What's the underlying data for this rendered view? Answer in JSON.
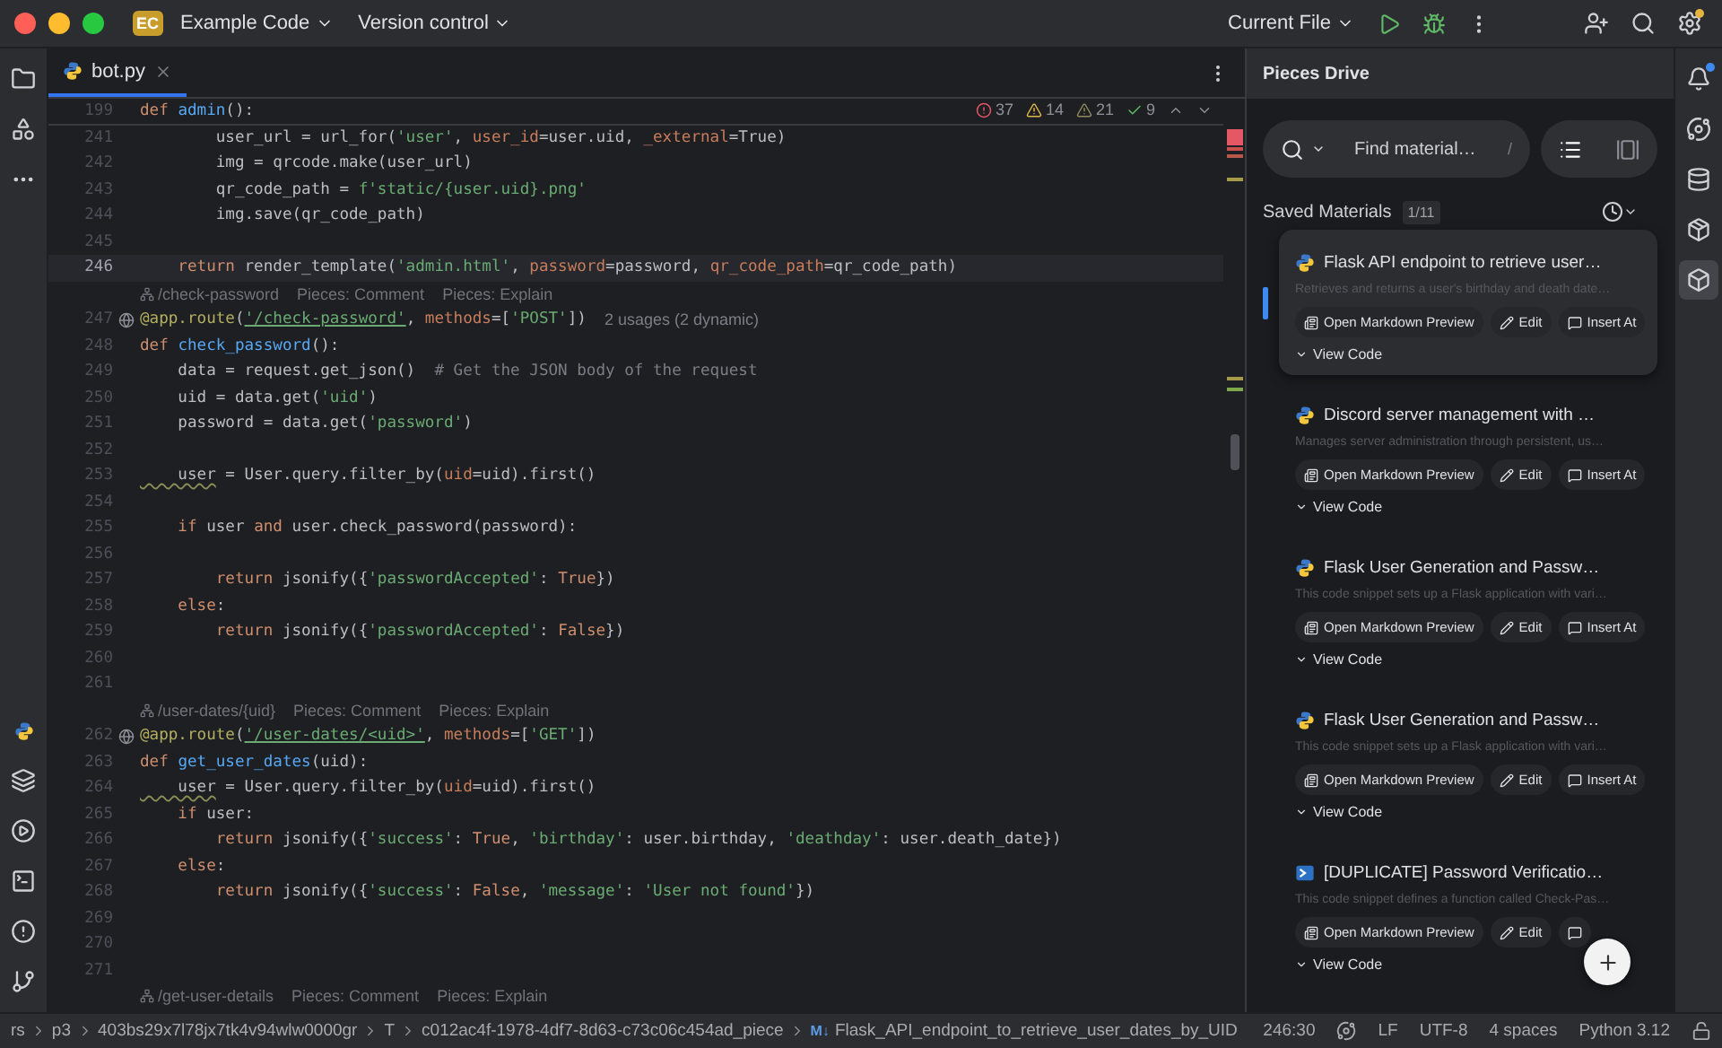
{
  "titlebar": {
    "project_badge": "EC",
    "project": "Example Code",
    "vcs": "Version control",
    "run_config": "Current File"
  },
  "left_toolbar": [
    {
      "selected": false
    },
    {
      "selected": false
    }
  ],
  "right_toolbar": [
    {
      "selected": false
    },
    {
      "selected": false
    },
    {
      "selected": false
    },
    {
      "selected": false
    },
    {
      "selected": true
    }
  ],
  "tabs": [
    {
      "label": "bot.py",
      "selected": true
    }
  ],
  "inspections": [
    {
      "kind": "error",
      "count": "37"
    },
    {
      "kind": "warning",
      "count": "14"
    },
    {
      "kind": "weak",
      "count": "21"
    },
    {
      "kind": "typo",
      "count": "9"
    }
  ],
  "editor": {
    "rows": [
      {
        "kind": "code",
        "num": "199",
        "sticky": true,
        "segs": [
          {
            "text": "def ",
            "kind": "k"
          },
          {
            "text": "admin",
            "kind": "f"
          },
          {
            "text": "():",
            "kind": "n"
          }
        ]
      },
      {
        "kind": "code",
        "num": "241",
        "segs": [
          {
            "text": "        user_url = url_for(",
            "kind": "n"
          },
          {
            "text": "'user'",
            "kind": "s"
          },
          {
            "text": ", ",
            "kind": "n"
          },
          {
            "text": "user_id",
            "kind": "p"
          },
          {
            "text": "=user.uid, ",
            "kind": "n"
          },
          {
            "text": "_external",
            "kind": "p"
          },
          {
            "text": "=True)",
            "kind": "n"
          }
        ]
      },
      {
        "kind": "code",
        "num": "242",
        "segs": [
          {
            "text": "        img = qrcode.make(user_url)",
            "kind": "n"
          }
        ]
      },
      {
        "kind": "code",
        "num": "243",
        "segs": [
          {
            "text": "        qr_code_path = ",
            "kind": "n"
          },
          {
            "text": "f'static/{user.uid}.png'",
            "kind": "s"
          }
        ]
      },
      {
        "kind": "code",
        "num": "244",
        "segs": [
          {
            "text": "        img.save(qr_code_path)",
            "kind": "n"
          }
        ]
      },
      {
        "kind": "code",
        "num": "245"
      },
      {
        "kind": "code",
        "num": "246",
        "current": true,
        "segs": [
          {
            "text": "    return",
            "kind": "k"
          },
          {
            "text": " render_template(",
            "kind": "n"
          },
          {
            "text": "'admin.html'",
            "kind": "s"
          },
          {
            "text": ", ",
            "kind": "n"
          },
          {
            "text": "password",
            "kind": "p"
          },
          {
            "text": "=password, ",
            "kind": "n"
          },
          {
            "text": "qr_code_path",
            "kind": "p"
          },
          {
            "text": "=qr_code_path)",
            "kind": "n"
          }
        ]
      },
      {
        "kind": "hint",
        "route": "/check-password",
        "links": [
          "Pieces: Comment",
          "Pieces: Explain"
        ]
      },
      {
        "kind": "code",
        "num": "247",
        "route_marker": true,
        "inlay": "2 usages (2 dynamic)",
        "segs": [
          {
            "text": "@app.route",
            "kind": "d"
          },
          {
            "text": "(",
            "kind": "n"
          },
          {
            "text": "'/check-password'",
            "kind": "u"
          },
          {
            "text": ", ",
            "kind": "n"
          },
          {
            "text": "methods",
            "kind": "p"
          },
          {
            "text": "=[",
            "kind": "n"
          },
          {
            "text": "'POST'",
            "kind": "s"
          },
          {
            "text": "])",
            "kind": "n"
          }
        ]
      },
      {
        "kind": "code",
        "num": "248",
        "segs": [
          {
            "text": "def ",
            "kind": "k"
          },
          {
            "text": "check_password",
            "kind": "f"
          },
          {
            "text": "():",
            "kind": "n"
          }
        ]
      },
      {
        "kind": "code",
        "num": "249",
        "segs": [
          {
            "text": "    data = request.get_json()  ",
            "kind": "n"
          },
          {
            "text": "# Get the JSON body of the request",
            "kind": "c"
          }
        ]
      },
      {
        "kind": "code",
        "num": "250",
        "segs": [
          {
            "text": "    uid = data.get(",
            "kind": "n"
          },
          {
            "text": "'uid'",
            "kind": "s"
          },
          {
            "text": ")",
            "kind": "n"
          }
        ]
      },
      {
        "kind": "code",
        "num": "251",
        "segs": [
          {
            "text": "    password = data.get(",
            "kind": "n"
          },
          {
            "text": "'password'",
            "kind": "s"
          },
          {
            "text": ")",
            "kind": "n"
          }
        ]
      },
      {
        "kind": "code",
        "num": "252"
      },
      {
        "kind": "code",
        "num": "253",
        "segs": [
          {
            "text": "    user",
            "kind": "w"
          },
          {
            "text": " = User.query.filter_by(",
            "kind": "n"
          },
          {
            "text": "uid",
            "kind": "p"
          },
          {
            "text": "=uid).first()",
            "kind": "n"
          }
        ]
      },
      {
        "kind": "code",
        "num": "254"
      },
      {
        "kind": "code",
        "num": "255",
        "segs": [
          {
            "text": "    if",
            "kind": "k"
          },
          {
            "text": " user ",
            "kind": "n"
          },
          {
            "text": "and",
            "kind": "k"
          },
          {
            "text": " user.check_password(password):",
            "kind": "n"
          }
        ]
      },
      {
        "kind": "code",
        "num": "256"
      },
      {
        "kind": "code",
        "num": "257",
        "segs": [
          {
            "text": "        return",
            "kind": "k"
          },
          {
            "text": " jsonify({",
            "kind": "n"
          },
          {
            "text": "'passwordAccepted'",
            "kind": "s"
          },
          {
            "text": ": ",
            "kind": "n"
          },
          {
            "text": "True",
            "kind": "k"
          },
          {
            "text": "})",
            "kind": "n"
          }
        ]
      },
      {
        "kind": "code",
        "num": "258",
        "segs": [
          {
            "text": "    else",
            "kind": "k"
          },
          {
            "text": ":",
            "kind": "n"
          }
        ]
      },
      {
        "kind": "code",
        "num": "259",
        "segs": [
          {
            "text": "        return",
            "kind": "k"
          },
          {
            "text": " jsonify({",
            "kind": "n"
          },
          {
            "text": "'passwordAccepted'",
            "kind": "s"
          },
          {
            "text": ": ",
            "kind": "n"
          },
          {
            "text": "False",
            "kind": "k"
          },
          {
            "text": "})",
            "kind": "n"
          }
        ]
      },
      {
        "kind": "code",
        "num": "260"
      },
      {
        "kind": "code",
        "num": "261"
      },
      {
        "kind": "hint",
        "route": "/user-dates/{uid}",
        "links": [
          "Pieces: Comment",
          "Pieces: Explain"
        ]
      },
      {
        "kind": "code",
        "num": "262",
        "route_marker": true,
        "segs": [
          {
            "text": "@app.route",
            "kind": "d"
          },
          {
            "text": "(",
            "kind": "n"
          },
          {
            "text": "'/user-dates/<uid>'",
            "kind": "u"
          },
          {
            "text": ", ",
            "kind": "n"
          },
          {
            "text": "methods",
            "kind": "p"
          },
          {
            "text": "=[",
            "kind": "n"
          },
          {
            "text": "'GET'",
            "kind": "s"
          },
          {
            "text": "])",
            "kind": "n"
          }
        ]
      },
      {
        "kind": "code",
        "num": "263",
        "segs": [
          {
            "text": "def ",
            "kind": "k"
          },
          {
            "text": "get_user_dates",
            "kind": "f"
          },
          {
            "text": "(uid):",
            "kind": "n"
          }
        ]
      },
      {
        "kind": "code",
        "num": "264",
        "segs": [
          {
            "text": "    user",
            "kind": "w"
          },
          {
            "text": " = User.query.filter_by(",
            "kind": "n"
          },
          {
            "text": "uid",
            "kind": "p"
          },
          {
            "text": "=uid).first()",
            "kind": "n"
          }
        ]
      },
      {
        "kind": "code",
        "num": "265",
        "segs": [
          {
            "text": "    if",
            "kind": "k"
          },
          {
            "text": " user:",
            "kind": "n"
          }
        ]
      },
      {
        "kind": "code",
        "num": "266",
        "segs": [
          {
            "text": "        return",
            "kind": "k"
          },
          {
            "text": " jsonify({",
            "kind": "n"
          },
          {
            "text": "'success'",
            "kind": "s"
          },
          {
            "text": ": ",
            "kind": "n"
          },
          {
            "text": "True",
            "kind": "k"
          },
          {
            "text": ", ",
            "kind": "n"
          },
          {
            "text": "'birthday'",
            "kind": "s"
          },
          {
            "text": ": user.birthday, ",
            "kind": "n"
          },
          {
            "text": "'deathday'",
            "kind": "s"
          },
          {
            "text": ": user.death_date})",
            "kind": "n"
          }
        ]
      },
      {
        "kind": "code",
        "num": "267",
        "segs": [
          {
            "text": "    else",
            "kind": "k"
          },
          {
            "text": ":",
            "kind": "n"
          }
        ]
      },
      {
        "kind": "code",
        "num": "268",
        "segs": [
          {
            "text": "        return",
            "kind": "k"
          },
          {
            "text": " jsonify({",
            "kind": "n"
          },
          {
            "text": "'success'",
            "kind": "s"
          },
          {
            "text": ": ",
            "kind": "n"
          },
          {
            "text": "False",
            "kind": "k"
          },
          {
            "text": ", ",
            "kind": "n"
          },
          {
            "text": "'message'",
            "kind": "s"
          },
          {
            "text": ": ",
            "kind": "n"
          },
          {
            "text": "'User not found'",
            "kind": "s"
          },
          {
            "text": "})",
            "kind": "n"
          }
        ]
      },
      {
        "kind": "code",
        "num": "269"
      },
      {
        "kind": "code",
        "num": "270"
      },
      {
        "kind": "code",
        "num": "271"
      },
      {
        "kind": "hint",
        "route": "/get-user-details",
        "links": [
          "Pieces: Comment",
          "Pieces: Explain"
        ]
      }
    ]
  },
  "pieces": {
    "title": "Pieces Drive",
    "search": {
      "placeholder": "Find material…",
      "shortcut": "/"
    },
    "views": [
      {
        "selected": true
      },
      {
        "selected": false
      }
    ],
    "section": "Saved Materials",
    "count": "1/11",
    "materials": [
      {
        "kind": "python",
        "selected": true,
        "title": "Flask API endpoint to retrieve user…",
        "description": "Retrieves and returns a user's birthday and death date…",
        "actions": [
          {
            "kind": "preview",
            "label": "Open Markdown Preview"
          },
          {
            "kind": "edit",
            "label": "Edit"
          },
          {
            "kind": "insert",
            "label": "Insert At"
          }
        ],
        "toggle": "View Code"
      },
      {
        "kind": "python",
        "selected": false,
        "title": "Discord server management with …",
        "description": "Manages server administration through persistent, us…",
        "actions": [
          {
            "kind": "preview",
            "label": "Open Markdown Preview"
          },
          {
            "kind": "edit",
            "label": "Edit"
          },
          {
            "kind": "insert",
            "label": "Insert At"
          }
        ],
        "toggle": "View Code"
      },
      {
        "kind": "python",
        "selected": false,
        "title": "Flask User Generation and Passw…",
        "description": "This code snippet sets up a Flask application with vari…",
        "actions": [
          {
            "kind": "preview",
            "label": "Open Markdown Preview"
          },
          {
            "kind": "edit",
            "label": "Edit"
          },
          {
            "kind": "insert",
            "label": "Insert At"
          }
        ],
        "toggle": "View Code"
      },
      {
        "kind": "python",
        "selected": false,
        "title": "Flask User Generation and Passw…",
        "description": "This code snippet sets up a Flask application with vari…",
        "actions": [
          {
            "kind": "preview",
            "label": "Open Markdown Preview"
          },
          {
            "kind": "edit",
            "label": "Edit"
          },
          {
            "kind": "insert",
            "label": "Insert At"
          }
        ],
        "toggle": "View Code"
      },
      {
        "kind": "powershell",
        "selected": false,
        "title": "[DUPLICATE] Password Verificatio…",
        "description": "This code snippet defines a function called Check-Pas…",
        "actions": [
          {
            "kind": "preview",
            "label": "Open Markdown Preview"
          },
          {
            "kind": "edit",
            "label": "Edit"
          },
          {
            "kind": "insert"
          }
        ],
        "toggle": "View Code"
      }
    ]
  },
  "status": {
    "breadcrumbs": [
      {
        "label": "rs"
      },
      {
        "label": "p3"
      },
      {
        "label": "403bs29x7l78jx7tk4v94wlw0000gr"
      },
      {
        "label": "T"
      },
      {
        "label": "c012ac4f-1978-4df7-8d63-c73c06c454ad_piece"
      },
      {
        "label": "Flask_API_endpoint_to_retrieve_user_dates_by_UID",
        "badge": "M↓"
      }
    ],
    "position": "246:30",
    "line_sep": "LF",
    "encoding": "UTF-8",
    "indent": "4 spaces",
    "interpreter": "Python 3.12"
  }
}
